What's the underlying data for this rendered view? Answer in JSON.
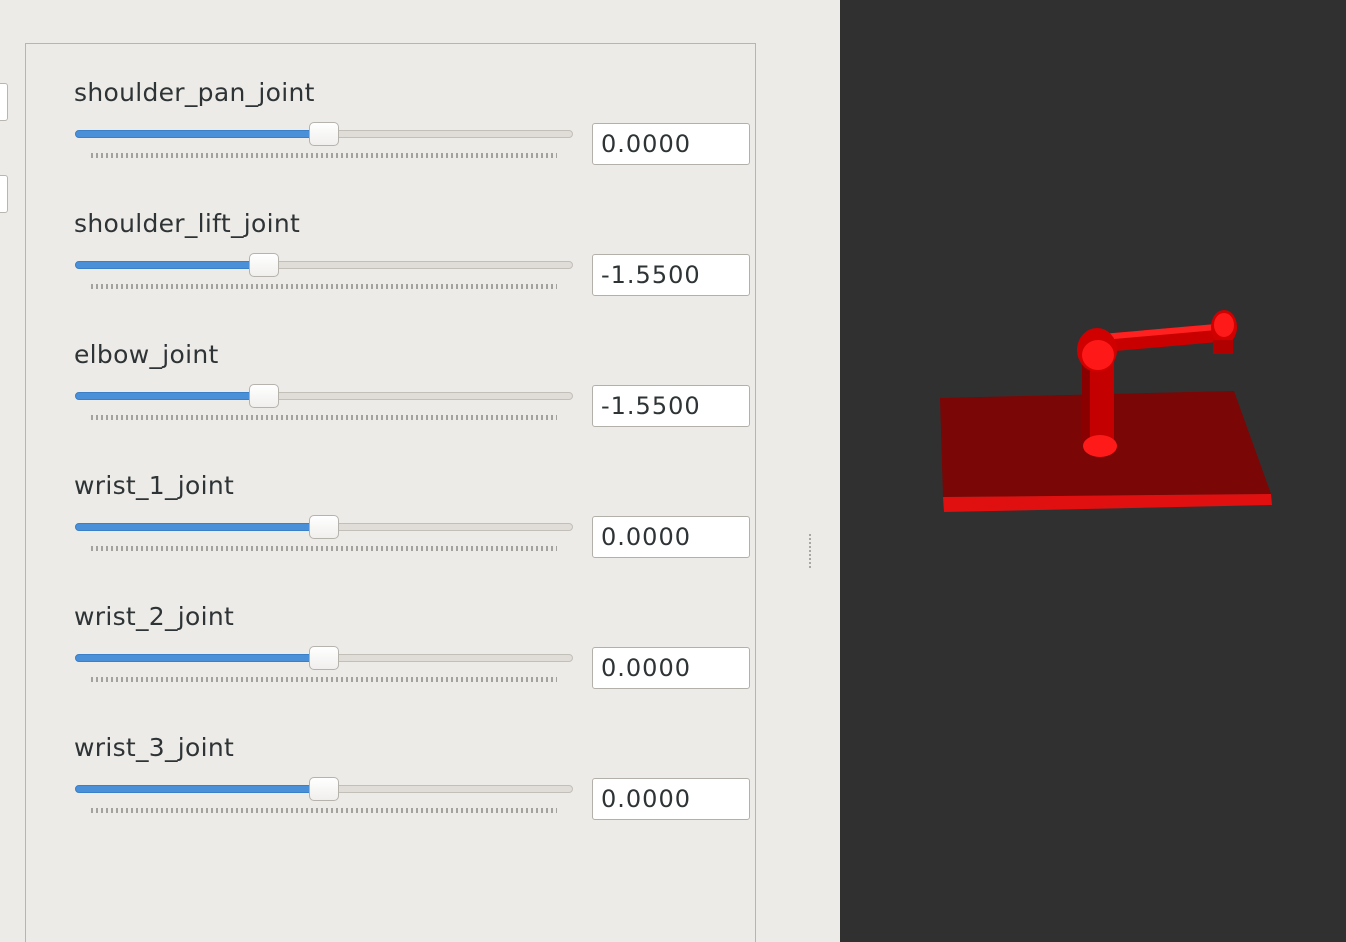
{
  "joints": [
    {
      "name": "shoulder_pan_joint",
      "value": "0.0000",
      "position": 0.5
    },
    {
      "name": "shoulder_lift_joint",
      "value": "-1.5500",
      "position": 0.38
    },
    {
      "name": "elbow_joint",
      "value": "-1.5500",
      "position": 0.38
    },
    {
      "name": "wrist_1_joint",
      "value": "0.0000",
      "position": 0.5
    },
    {
      "name": "wrist_2_joint",
      "value": "0.0000",
      "position": 0.5
    },
    {
      "name": "wrist_3_joint",
      "value": "0.0000",
      "position": 0.5
    }
  ],
  "colors": {
    "panel_background": "#edebe7",
    "slider_accent": "#4a90d9",
    "viewport_background": "#303030",
    "robot_color": "#e00000"
  }
}
